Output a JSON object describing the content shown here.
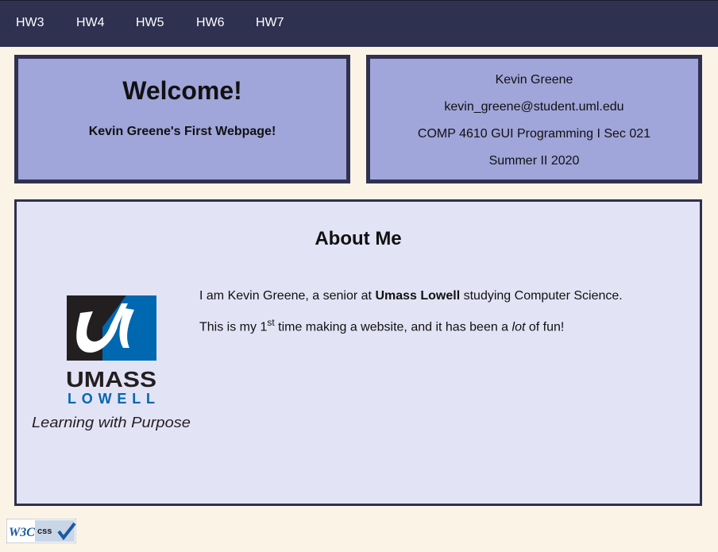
{
  "nav": {
    "items": [
      "HW3",
      "HW4",
      "HW5",
      "HW6",
      "HW7"
    ]
  },
  "welcome": {
    "title": "Welcome!",
    "subtitle": "Kevin Greene's First Webpage!"
  },
  "info": {
    "name": "Kevin Greene",
    "email": "kevin_greene@student.uml.edu",
    "course": "COMP 4610 GUI Programming I Sec 021",
    "term": "Summer II 2020"
  },
  "about": {
    "heading": "About Me",
    "line1_a": "I am Kevin Greene, a senior at ",
    "line1_bold": "Umass Lowell",
    "line1_b": " studying Computer Science.",
    "line2_a": "This is my 1",
    "line2_sup": "st",
    "line2_b": " time making a website, and it has been a ",
    "line2_italic": "lot",
    "line2_c": " of fun!"
  },
  "logo": {
    "word1": "UMASS",
    "word2": "LOWELL",
    "tagline": "Learning with Purpose",
    "color_blue": "#0067b1",
    "color_dark": "#231f20"
  },
  "badge": {
    "w3c": "W3C",
    "css": "css"
  },
  "colors": {
    "nav_bg": "#2e3150",
    "page_bg": "#fbf4e6",
    "box_bg": "#a0a5da",
    "about_bg": "#e3e3f6"
  }
}
